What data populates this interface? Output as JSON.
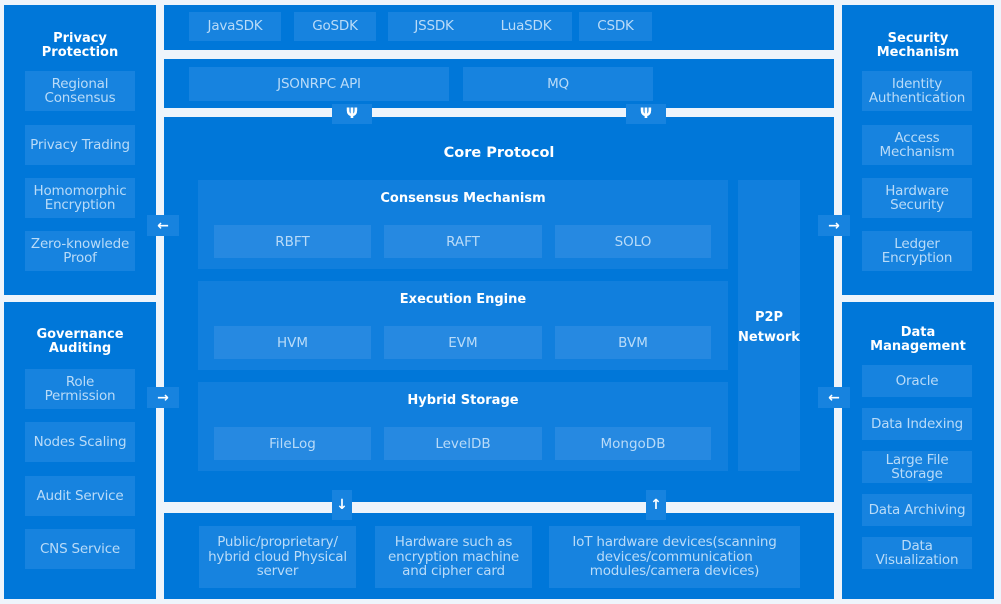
{
  "sdk_layer": {
    "items": [
      "JavaSDK",
      "GoSDK",
      "JSSDK",
      "LuaSDK",
      "CSDK"
    ]
  },
  "api_layer": {
    "items": [
      "JSONRPC API",
      "MQ"
    ]
  },
  "core": {
    "title": "Core Protocol",
    "consensus": {
      "title": "Consensus Mechanism",
      "items": [
        "RBFT",
        "RAFT",
        "SOLO"
      ]
    },
    "execution": {
      "title": "Execution Engine",
      "items": [
        "HVM",
        "EVM",
        "BVM"
      ]
    },
    "storage": {
      "title": "Hybrid Storage",
      "items": [
        "FileLog",
        "LevelDB",
        "MongoDB"
      ]
    },
    "p2p": {
      "line1": "P2P",
      "line2": "Network"
    }
  },
  "infrastructure": {
    "items": [
      "Public/proprietary/ hybrid cloud Physical server",
      "Hardware such as encryption machine and cipher card",
      "IoT hardware devices(scanning devices/communication modules/camera devices)"
    ]
  },
  "privacy": {
    "title_line1": "Privacy",
    "title_line2": "Protection",
    "items": [
      "Regional Consensus",
      "Privacy Trading",
      "Homomorphic Encryption",
      "Zero-knowlede Proof"
    ]
  },
  "governance": {
    "title_line1": "Governance",
    "title_line2": "Auditing",
    "items": [
      "Role Permission",
      "Nodes Scaling",
      "Audit Service",
      "CNS Service"
    ]
  },
  "security": {
    "title_line1": "Security",
    "title_line2": "Mechanism",
    "items": [
      "Identity Authentication",
      "Access Mechanism",
      "Hardware Security",
      "Ledger Encryption"
    ]
  },
  "data_management": {
    "title_line1": "Data",
    "title_line2": "Management",
    "items": [
      "Oracle",
      "Data Indexing",
      "Large File Storage",
      "Data Archiving",
      "Data Visualization"
    ]
  },
  "arrows": {
    "left": "←",
    "right": "→",
    "up": "↑",
    "down": "↓",
    "fork": "Ψ"
  },
  "colors": {
    "panel": "#0077d9",
    "cell": "#1783df",
    "background": "#eef4fb",
    "cell_text": "#b9dbf8"
  }
}
